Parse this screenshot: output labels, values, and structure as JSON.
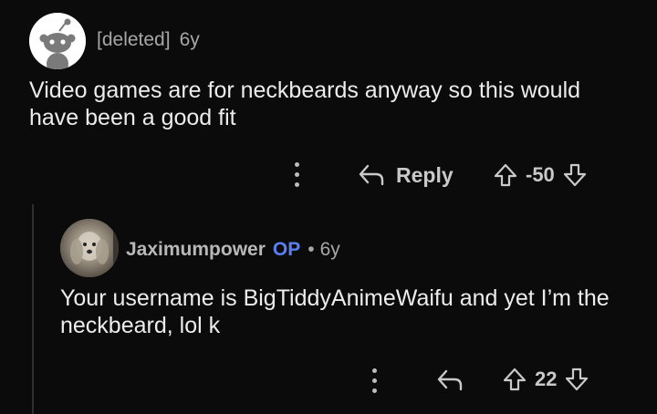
{
  "comments": [
    {
      "author": "[deleted]",
      "age": "6y",
      "body": "Video games are for neckbeards anyway so this would have been a good fit",
      "reply_label": "Reply",
      "score": "-50"
    },
    {
      "author": "Jaximumpower",
      "op_badge": "OP",
      "separator": "•",
      "age": "6y",
      "body": "Your username is BigTiddyAnimeWaifu and yet I’m the neckbeard, lol k",
      "score": "22"
    }
  ],
  "colors": {
    "background": "#0b0b0c",
    "text": "#ececec",
    "muted": "#a7a7a7",
    "op_badge": "#5a7ff0"
  },
  "icons": [
    "snoo-avatar-icon",
    "more-options-icon",
    "reply-arrow-icon",
    "upvote-arrow-icon",
    "downvote-arrow-icon"
  ]
}
